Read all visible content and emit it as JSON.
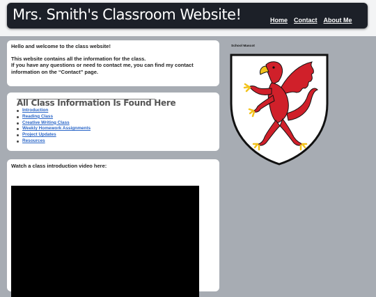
{
  "header": {
    "title": "Mrs. Smith's Classroom Website!",
    "nav": [
      "Home",
      "Contact",
      "About Me"
    ]
  },
  "welcome": {
    "line1": "Hello and welcome to the class website!",
    "line2": "This website contains all the information for the class.",
    "line3": "If you have any questions or need to contact me, you can find my contact information on the “Contact” page."
  },
  "class_info": {
    "heading": "All Class Information Is Found Here",
    "links": [
      "Introduction",
      "Reading Class",
      "Creative Writing Class",
      "Weekly Homework Assignments",
      "Project Updates",
      "Resources"
    ]
  },
  "video": {
    "caption": "Watch a class introduction video here:"
  },
  "mascot": {
    "label": "School Mascot"
  },
  "colors": {
    "header_bg": "#1c2028",
    "page_bg": "#a7acb3",
    "link": "#2a66c8",
    "griffin_red": "#d0202a",
    "griffin_gold": "#f2c21b"
  }
}
